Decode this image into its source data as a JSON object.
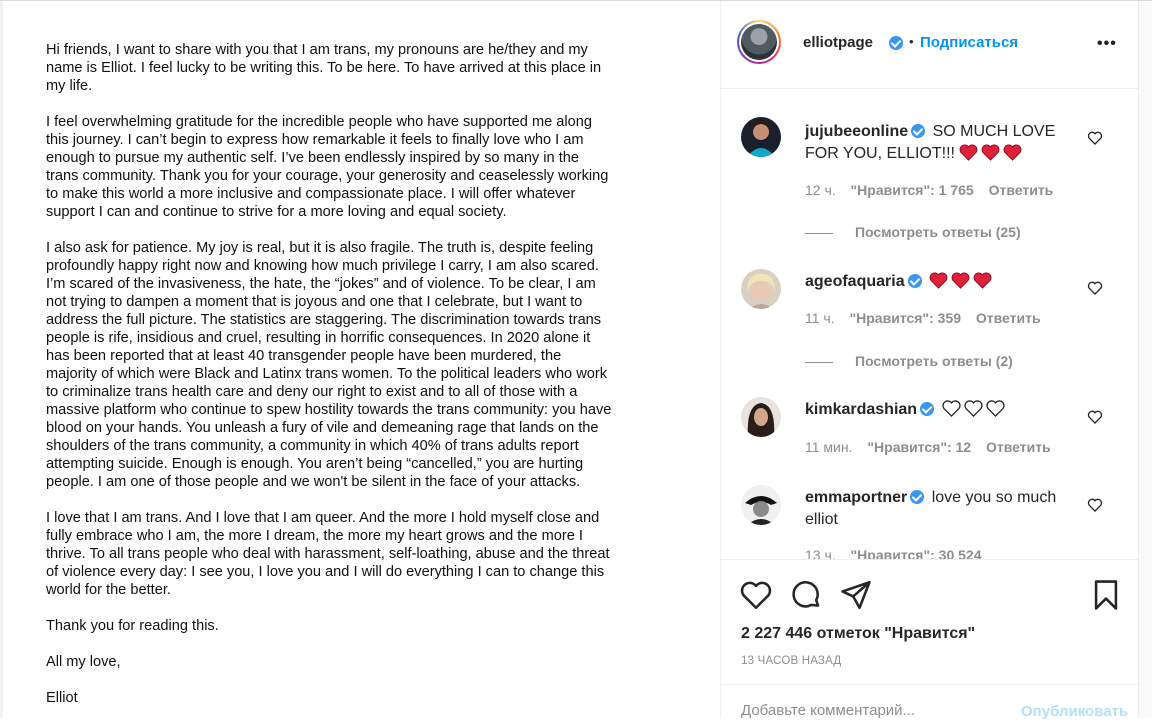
{
  "letter": {
    "paragraphs": [
      "Hi friends, I want to share with you that I am trans, my pronouns are he/they and my\nname is Elliot. I feel lucky to be writing this. To be here. To have arrived at this place in\nmy life.",
      "I feel overwhelming gratitude for the incredible people who have supported me along\nthis journey. I can’t begin to express how remarkable it feels to finally love who I am\nenough to pursue my authentic self. I’ve been endlessly inspired by so many in the\ntrans community. Thank you for your courage, your generosity and ceaselessly working\nto make this world a more inclusive and compassionate place. I will offer whatever\nsupport I can and continue to strive for a more loving and equal society.",
      "I also ask for patience. My joy is real, but it is also fragile. The truth is, despite feeling\nprofoundly happy right now and knowing how much privilege I carry, I am also scared.\nI’m scared of the invasiveness, the hate, the “jokes” and of violence. To be clear, I am\nnot trying to dampen a moment that is joyous and one that I celebrate, but I want to\naddress the full picture. The statistics are staggering. The discrimination towards trans\npeople is rife, insidious and cruel, resulting in horrific consequences. In 2020 alone it\nhas been reported that at least 40 transgender people have been murdered, the\nmajority of which were Black and Latinx trans women. To the political leaders who work\nto criminalize trans health care and deny our right to exist and to all of those with a\nmassive platform who continue to spew hostility towards the trans community: you have\nblood on your hands. You unleash a fury of vile and demeaning rage that lands on the\nshoulders of the trans community, a community in which 40% of trans adults report\nattempting suicide. Enough is enough. You aren’t being “cancelled,” you are hurting\npeople. I am one of those people and we won't be silent in the face of your attacks.",
      "I love that I am trans. And I love that I am queer. And the more I hold myself close and\nfully embrace who I am, the more I dream, the more my heart grows and the more I\nthrive. To all trans people who deal with harassment, self-loathing, abuse and the threat\nof violence every day: I see you, I love you and I will do everything I can to change this\nworld for the better.",
      "Thank you for reading this.",
      "All my love,",
      "Elliot"
    ]
  },
  "header": {
    "username": "elliotpage",
    "dot": "•",
    "follow_label": "Подписаться",
    "more_label": "•••"
  },
  "comments": [
    {
      "username": "jujubeeonline",
      "text": "SO MUCH LOVE FOR YOU, ELLIOT!!!",
      "emoji": "red-hearts x3",
      "time": "12 ч.",
      "likes": "\"Нравится\": 1 765",
      "reply": "Ответить",
      "view_replies": "Посмотреть ответы (25)"
    },
    {
      "username": "ageofaquaria",
      "text": "",
      "emoji": "red-hearts x3",
      "time": "11 ч.",
      "likes": "\"Нравится\": 359",
      "reply": "Ответить",
      "view_replies": "Посмотреть ответы (2)"
    },
    {
      "username": "kimkardashian",
      "text": "",
      "emoji": "white-hearts x3",
      "time": "11 мин.",
      "likes": "\"Нравится\": 12",
      "reply": "Ответить"
    },
    {
      "username": "emmaportner",
      "text": "love you so much elliot",
      "time": "13 ч.",
      "likes": "\"Нравится\": 30 524"
    }
  ],
  "actions": {
    "likes_count": "2 227 446 отметок \"Нравится\"",
    "timestamp": "13 ЧАСОВ НАЗАД"
  },
  "add_comment": {
    "placeholder": "Добавьте комментарий...",
    "publish_label": "Опубликовать"
  },
  "colors": {
    "link_blue": "#0095f6",
    "verified_blue": "#3897f0",
    "muted_text": "#8e8e8e",
    "heart_red": "#e0203a"
  }
}
